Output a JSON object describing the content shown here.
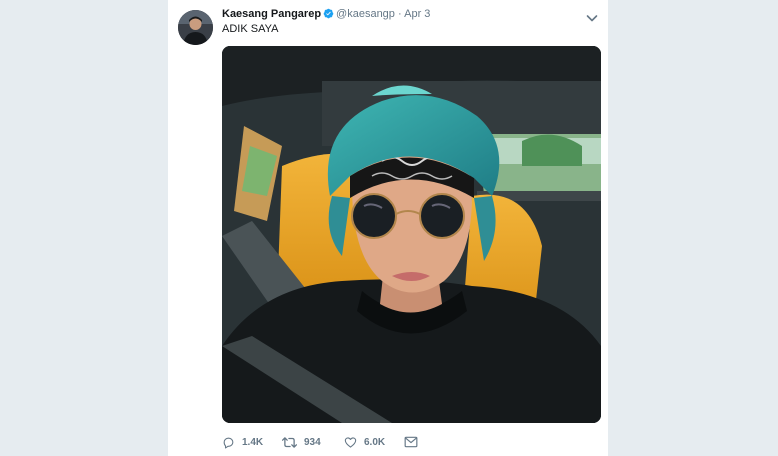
{
  "tweet": {
    "display_name": "Kaesang Pangarep",
    "verified_icon": "verified-badge-icon",
    "handle": "@kaesangp",
    "separator": "·",
    "timestamp": "Apr 3",
    "text": "ADIK SAYA",
    "media_icon": "selfie-photo",
    "actions": {
      "reply_count": "1.4K",
      "retweet_count": "934",
      "like_count": "6.0K"
    }
  },
  "colors": {
    "page_bg": "#e6ecf0",
    "card_bg": "#ffffff",
    "verified": "#1da1f2",
    "muted": "#657786"
  }
}
